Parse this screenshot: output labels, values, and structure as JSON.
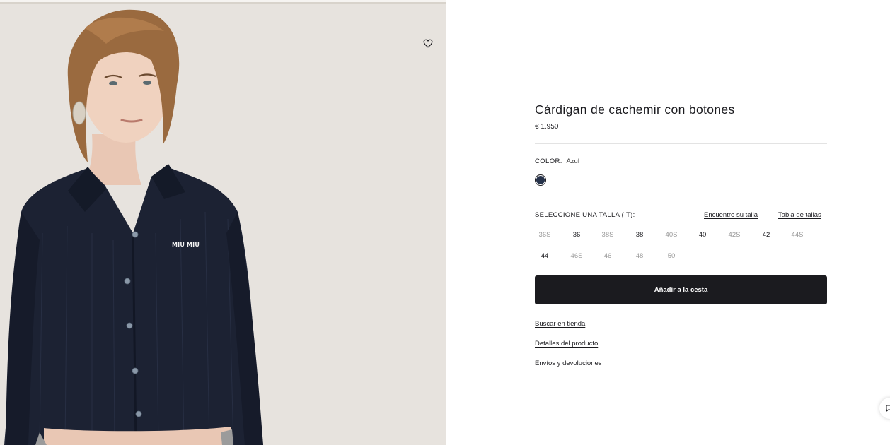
{
  "product": {
    "title": "Cárdigan de cachemir con botones",
    "price": "€ 1.950",
    "image_alt": "Modelo con cárdigan azul marino de punto calado con logo MIU MIU",
    "logo_text": "MIU MIU"
  },
  "color": {
    "label": "COLOR:",
    "value": "Azul",
    "swatch_hex": "#26324a"
  },
  "sizes": {
    "label": "SELECCIONE UNA TALLA (IT):",
    "find_size_link": "Encuentre su talla",
    "size_chart_link": "Tabla de tallas",
    "options": [
      {
        "label": "36S",
        "available": false
      },
      {
        "label": "36",
        "available": true
      },
      {
        "label": "38S",
        "available": false
      },
      {
        "label": "38",
        "available": true
      },
      {
        "label": "40S",
        "available": false
      },
      {
        "label": "40",
        "available": true
      },
      {
        "label": "42S",
        "available": false
      },
      {
        "label": "42",
        "available": true
      },
      {
        "label": "44S",
        "available": false
      },
      {
        "label": "44",
        "available": true
      },
      {
        "label": "46S",
        "available": false
      },
      {
        "label": "46",
        "available": false
      },
      {
        "label": "48",
        "available": false
      },
      {
        "label": "50",
        "available": false
      }
    ]
  },
  "actions": {
    "add_to_cart": "Añadir a la cesta",
    "find_in_store": "Buscar en tienda",
    "product_details": "Detalles del producto",
    "shipping_returns": "Envíos y devoluciones"
  },
  "icons": {
    "wishlist": "heart-icon",
    "chat": "chat-icon"
  },
  "colors": {
    "primary": "#1b1b1f",
    "unavailable": "#9a9a9a",
    "image_background": "#e8e4df",
    "garment": "#1c2233"
  }
}
